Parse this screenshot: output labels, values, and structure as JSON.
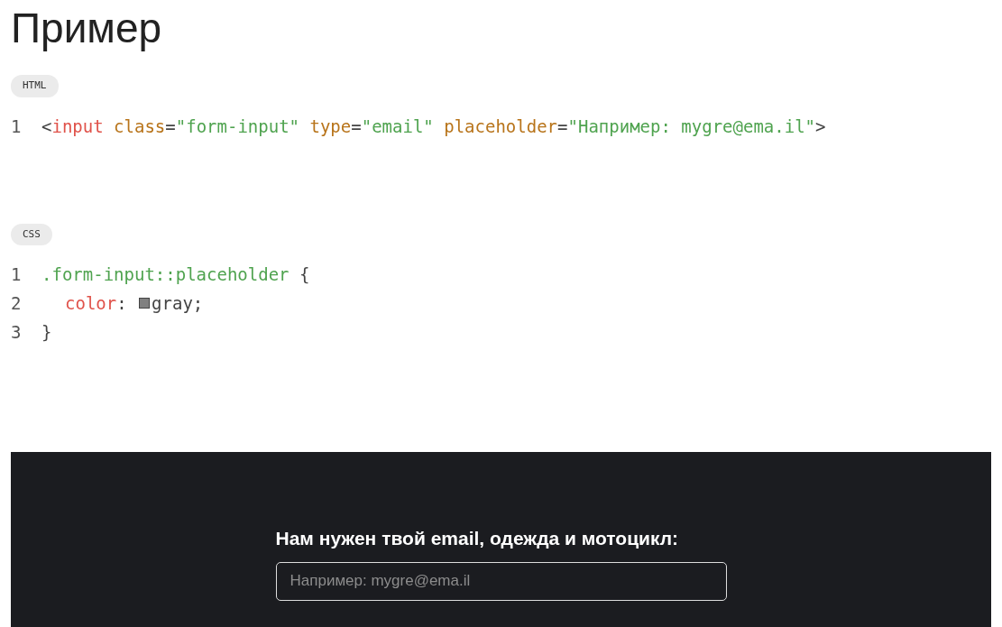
{
  "title": "Пример",
  "code_blocks": [
    {
      "language": "HTML",
      "lines": [
        {
          "number": "1",
          "indented": false,
          "tokens": [
            {
              "kind": "punct",
              "text": "<"
            },
            {
              "kind": "tag",
              "text": "input"
            },
            {
              "kind": "attr",
              "text": " class"
            },
            {
              "kind": "punct",
              "text": "="
            },
            {
              "kind": "string",
              "text": "\"form-input\""
            },
            {
              "kind": "attr",
              "text": " type"
            },
            {
              "kind": "punct",
              "text": "="
            },
            {
              "kind": "string",
              "text": "\"email\""
            },
            {
              "kind": "attr",
              "text": " placeholder"
            },
            {
              "kind": "punct",
              "text": "="
            },
            {
              "kind": "string",
              "text": "\"Например: mygre@ema.il\""
            },
            {
              "kind": "punct",
              "text": ">"
            }
          ]
        }
      ]
    },
    {
      "language": "CSS",
      "lines": [
        {
          "number": "1",
          "indented": false,
          "tokens": [
            {
              "kind": "string",
              "text": ".form-input::placeholder"
            },
            {
              "kind": "punct",
              "text": " {"
            }
          ]
        },
        {
          "number": "2",
          "indented": true,
          "tokens": [
            {
              "kind": "tag",
              "text": "color"
            },
            {
              "kind": "punct",
              "text": ": "
            },
            {
              "kind": "swatch",
              "color": "#808080"
            },
            {
              "kind": "punct",
              "text": "gray;"
            }
          ]
        },
        {
          "number": "3",
          "indented": false,
          "tokens": [
            {
              "kind": "punct",
              "text": "}"
            }
          ]
        }
      ]
    }
  ],
  "demo": {
    "heading": "Нам нужен твой email, одежда и мотоцикл:",
    "placeholder": "Например: mygre@ema.il"
  }
}
